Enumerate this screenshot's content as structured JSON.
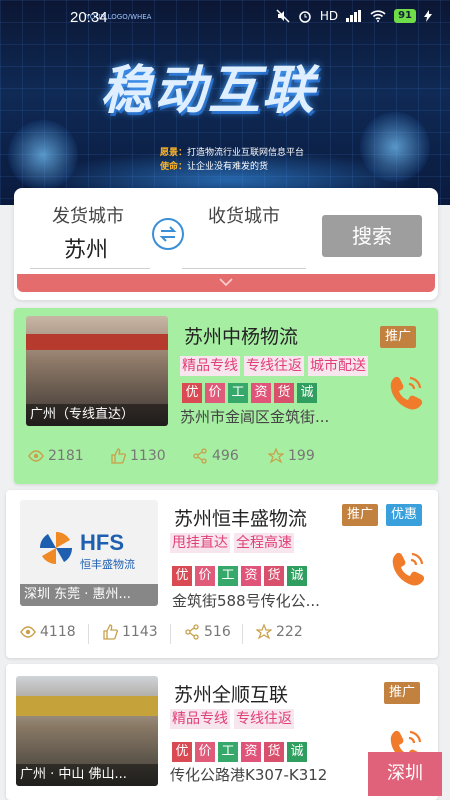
{
  "status_bar": {
    "time": "20:34",
    "network": "HD",
    "battery": "91"
  },
  "banner": {
    "small_text": "YOUR LOGO/WHEA",
    "title": "稳动互联",
    "vision_label": "愿景：",
    "vision_text": "打造物流行业互联网信息平台",
    "mission_label": "使命：",
    "mission_text": "让企业没有难发的货"
  },
  "search": {
    "from_label": "发货城市",
    "from_value": "苏州",
    "to_label": "收货城市",
    "to_value": "",
    "button_label": "搜索",
    "collapse_icon": "chevron-down-icon"
  },
  "colors": {
    "accent": "#e56c6c",
    "promo": "#c2813e",
    "discount": "#3aa0dc",
    "tag_pink": "#e0407a",
    "phone": "#f07b2b"
  },
  "companies": [
    {
      "name": "苏州中杨物流",
      "badges": [
        "推广"
      ],
      "photo_caption": "广州（专线直达）",
      "tags": [
        "精品专线",
        "专线往返",
        "城市配送"
      ],
      "chars": [
        "优",
        "价",
        "工",
        "资",
        "货",
        "诚"
      ],
      "address": "苏州市金阊区金筑街...",
      "views": "2181",
      "likes": "1130",
      "shares": "496",
      "stars": "199"
    },
    {
      "name": "苏州恒丰盛物流",
      "badges": [
        "推广",
        "优惠"
      ],
      "photo_caption": "深圳 东莞 · 惠州...",
      "logo_text": "HFS",
      "logo_sub": "恒丰盛物流",
      "tags": [
        "甩挂直达",
        "全程高速"
      ],
      "chars": [
        "优",
        "价",
        "工",
        "资",
        "货",
        "诚"
      ],
      "address": "金筑街588号传化公...",
      "views": "4118",
      "likes": "1143",
      "shares": "516",
      "stars": "222"
    },
    {
      "name": "苏州全顺互联",
      "badges": [
        "推广"
      ],
      "photo_caption": "广州 · 中山 佛山...",
      "tags": [
        "精品专线",
        "专线往返"
      ],
      "chars": [
        "优",
        "价",
        "工",
        "资",
        "货",
        "诚"
      ],
      "address": "传化公路港K307-K312"
    }
  ],
  "floating_city": "深圳"
}
